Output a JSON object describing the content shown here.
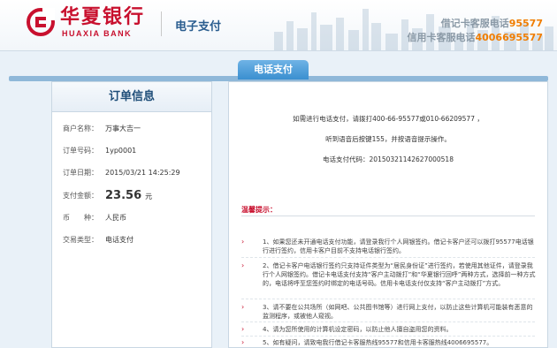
{
  "header": {
    "logo_cn": "华夏银行",
    "logo_en": "HUAXIA BANK",
    "title": "电子支付",
    "debit_hotline_label": "借记卡客服电话",
    "debit_hotline_number": "95577",
    "credit_hotline_label": "信用卡客服电话",
    "credit_hotline_number": "4006695577",
    "brand_color": "#c8102e",
    "hotline_color": "#f07d00"
  },
  "tab": {
    "label": "电话支付"
  },
  "order": {
    "title": "订单信息",
    "rows": [
      {
        "label": "商户名称：",
        "value": "万事大吉一"
      },
      {
        "label": "订单号码：",
        "value": "1yp0001"
      },
      {
        "label": "订单日期：",
        "value": "2015/03/21 14:25:29"
      },
      {
        "label": "支付金额：",
        "value": "23.56",
        "unit": "元"
      },
      {
        "label": "币　　种：",
        "value": "人民币"
      },
      {
        "label": "交易类型：",
        "value": "电话支付"
      }
    ]
  },
  "payment": {
    "instruction_1": "如需进行电话支付，请拨打400-66-95577或010-66209577 ，",
    "instruction_2": "听到语音后按键155，并按语音提示操作。",
    "code_label": "电话支付代码：",
    "code_value": "20150321142627000518"
  },
  "tips": {
    "title": "温馨提示：",
    "items": [
      "1、如果您还未开通电话支付功能，请登录我行个人网银签约。借记卡客户还可以拨打95577电话银行进行签约，信用卡客户目前不支持电话银行签约。",
      "2、借记卡客户电话银行签约只支持证件类型为“居民身份证”进行签约，若使用其他证件，请登录我行个人网银签约。借记卡电话支付支持“客户主动拨打”和“华夏银行回呼”两种方式，选择前一种方式的，电话将呼至您签约时绑定的电话号码。信用卡电话支付仅支持“客户主动拨打”方式。",
      "3、请不要在公共场所（如网吧、公共图书馆等）进行网上支付，以防止这些计算机可能装有恶意的监测程序，或被他人窥视。",
      "4、请为您所使用的计算机设定密码，以防止他人擅自盗用您的资料。",
      "5、如有疑问，请致电我行借记卡客服热线95577和信用卡客服热线4006695577。"
    ]
  }
}
